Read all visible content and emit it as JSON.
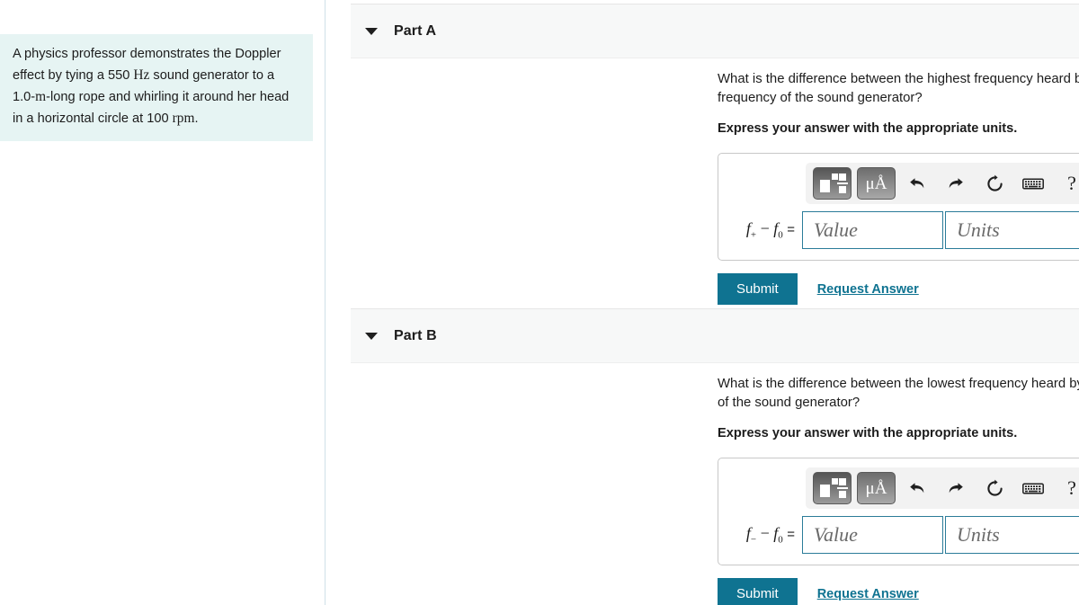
{
  "problem": {
    "text_1": "A physics professor demonstrates the Doppler effect by tying a 550 ",
    "unit_hz": "Hz",
    "text_2": " sound generator to a 1.0-",
    "unit_m": "m",
    "text_3": "-long rope and whirling it around her head in a horizontal circle at 100 ",
    "unit_rpm": "rpm",
    "text_4": "."
  },
  "parts": [
    {
      "title": "Part A",
      "caret": "collapse-caret-icon",
      "question": "What is the difference between the highest frequency heard by a student in the classroom and the initial frequency of the sound generator?",
      "express": "Express your answer with the appropriate units.",
      "var_f": "f",
      "var_sub": "+",
      "var_minus": "−",
      "var_f0": "f",
      "var_f0_sub": "0",
      "var_eq": "=",
      "value_placeholder": "Value",
      "value_current": "",
      "units_placeholder": "Units",
      "units_current": "",
      "submit_label": "Submit",
      "request_label": "Request Answer"
    },
    {
      "title": "Part B",
      "caret": "collapse-caret-icon",
      "question": "What is the difference between the lowest frequency heard by a student in the classroom and the initial frequency of the sound generator?",
      "express": "Express your answer with the appropriate units.",
      "var_f": "f",
      "var_sub": "−",
      "var_minus": "−",
      "var_f0": "f",
      "var_f0_sub": "0",
      "var_eq": "=",
      "value_placeholder": "Value",
      "value_current": "",
      "units_placeholder": "Units",
      "units_current": "",
      "submit_label": "Submit",
      "request_label": "Request Answer"
    }
  ],
  "toolbar": {
    "template_button": "math-template-button",
    "units_button_label": "μÅ",
    "undo": "undo-icon",
    "redo": "redo-icon",
    "reset": "reset-icon",
    "keyboard": "keyboard-icon",
    "help_label": "?"
  },
  "colors": {
    "accent": "#0f7391",
    "field_border": "#2b7c99",
    "problem_bg": "#e6f4f3",
    "header_bg": "#f7f8f8"
  }
}
